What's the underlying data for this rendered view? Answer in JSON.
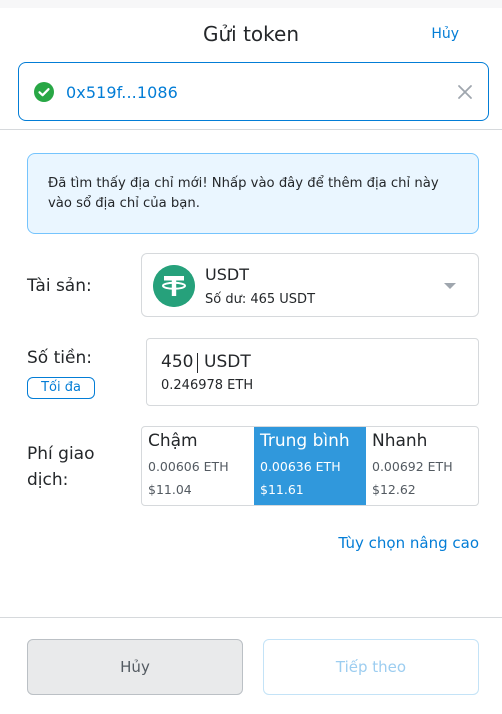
{
  "header": {
    "title": "Gửi token",
    "cancel_label": "Hủy",
    "recipient_address": "0x519f...1086"
  },
  "notice": {
    "text": "Đã tìm thấy địa chỉ mới! Nhấp vào đây để thêm địa chỉ này vào sổ địa chỉ của bạn."
  },
  "asset": {
    "label": "Tài sản:",
    "name": "USDT",
    "balance": "Số dư: 465 USDT",
    "icon": "tether-icon"
  },
  "amount": {
    "label": "Số tiền:",
    "max_label": "Tối đa",
    "value": "450",
    "unit": "USDT",
    "converted": "0.246978 ETH"
  },
  "fee": {
    "label_line1": "Phí giao",
    "label_line2": "dịch:",
    "options": [
      {
        "name": "Chậm",
        "eth": "0.00606 ETH",
        "usd": "$11.04",
        "selected": false
      },
      {
        "name": "Trung bình",
        "eth": "0.00636 ETH",
        "usd": "$11.61",
        "selected": true
      },
      {
        "name": "Nhanh",
        "eth": "0.00692 ETH",
        "usd": "$12.62",
        "selected": false
      }
    ]
  },
  "advanced_label": "Tùy chọn nâng cao",
  "footer": {
    "cancel_label": "Hủy",
    "next_label": "Tiếp theo"
  },
  "colors": {
    "accent": "#037dd6",
    "selected_fee": "#3098dc",
    "success": "#28a745",
    "tether": "#26a17b"
  }
}
